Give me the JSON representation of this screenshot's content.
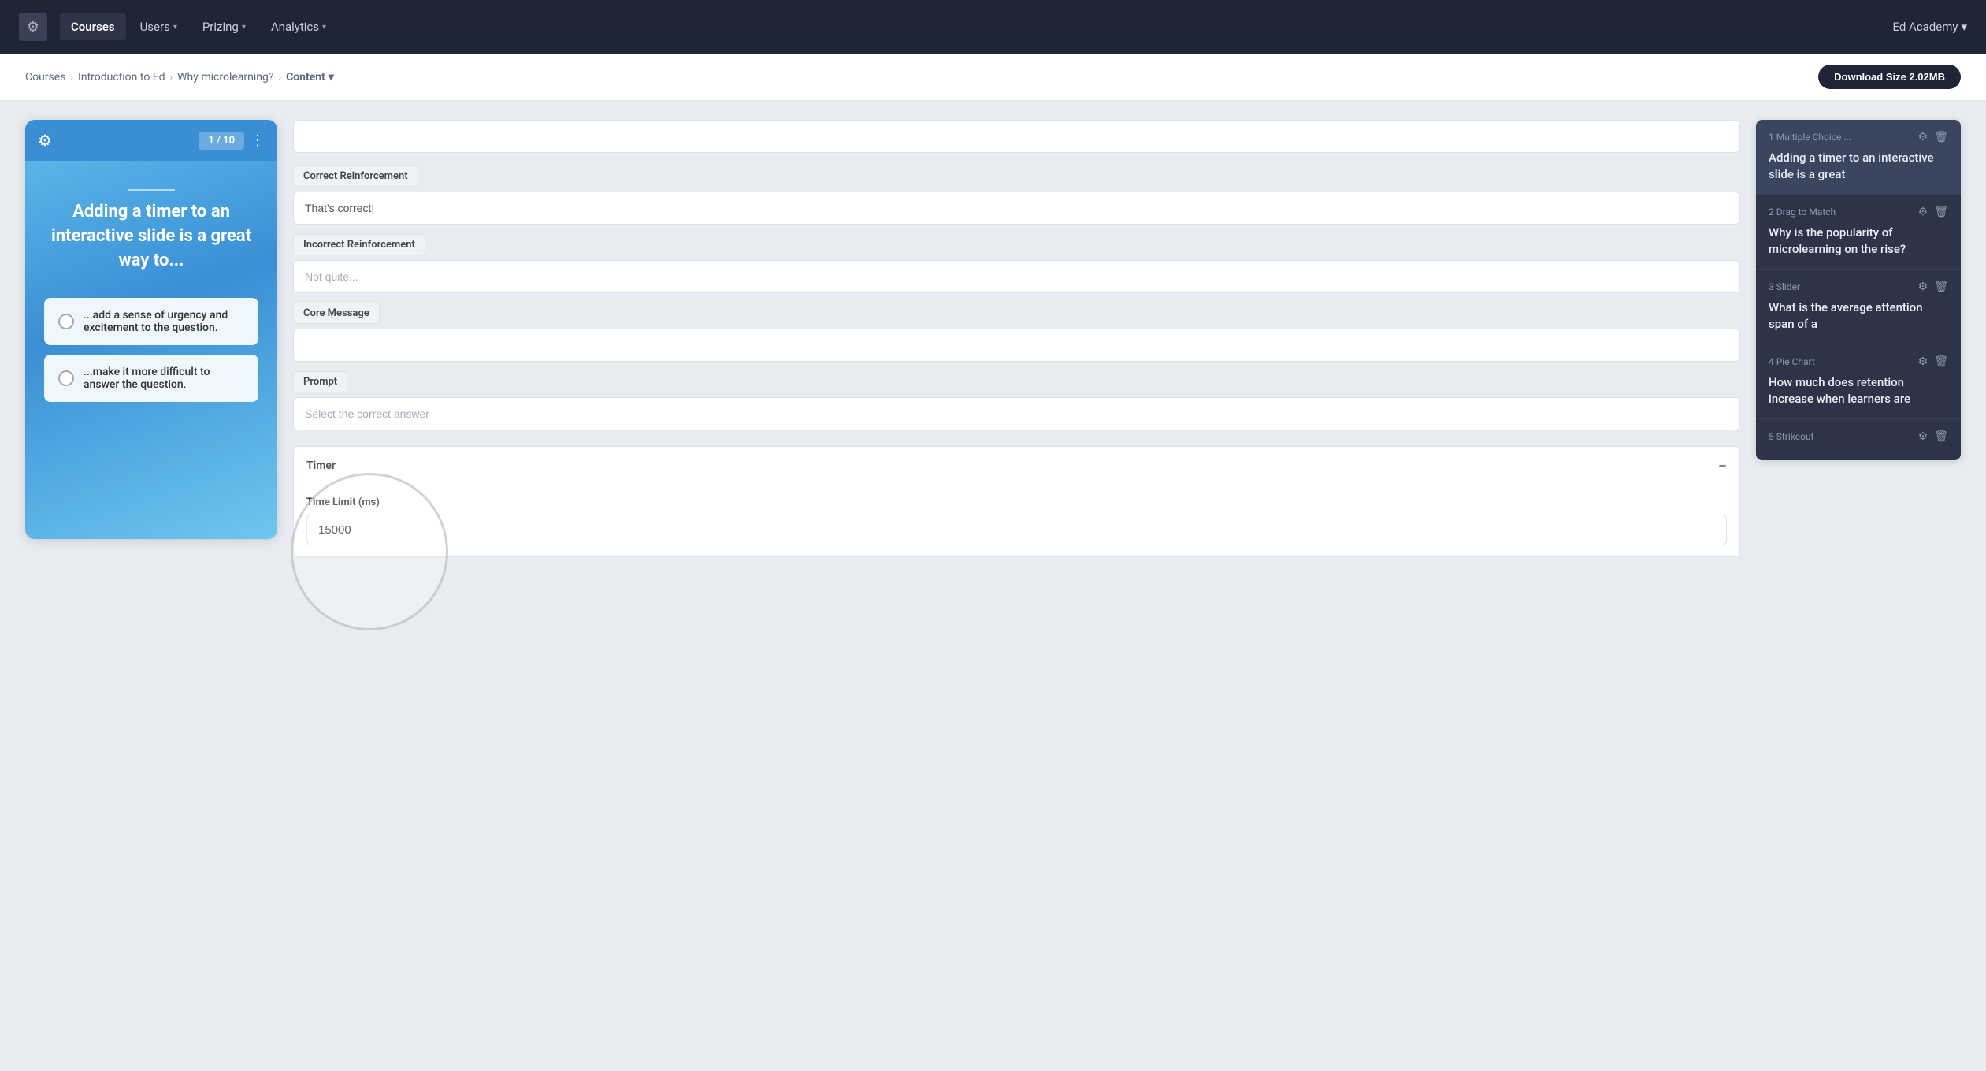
{
  "nav": {
    "logo_icon": "⚙",
    "items": [
      {
        "label": "Courses",
        "active": true
      },
      {
        "label": "Users",
        "has_arrow": true
      },
      {
        "label": "Prizing",
        "has_arrow": true
      },
      {
        "label": "Analytics",
        "has_arrow": true
      }
    ],
    "user_label": "Ed Academy",
    "user_arrow": "▾"
  },
  "breadcrumb": {
    "items": [
      "Courses",
      "Introduction to Ed",
      "Why microlearning?"
    ],
    "current": "Content",
    "current_arrow": "▾"
  },
  "download_button": "Download Size 2.02MB",
  "slide_preview": {
    "counter": "1 / 10",
    "title": "Adding a timer to an interactive slide is a great way to...",
    "options": [
      "...add a sense of urgency and excitement to the question.",
      "...make it more difficult to answer the question."
    ]
  },
  "form": {
    "top_input_placeholder": "",
    "correct_reinforcement": {
      "label": "Correct Reinforcement",
      "value": "That's correct!"
    },
    "incorrect_reinforcement": {
      "label": "Incorrect Reinforcement",
      "placeholder": "Not quite..."
    },
    "core_message": {
      "label": "Core Message",
      "value": ""
    },
    "prompt": {
      "label": "Prompt",
      "placeholder": "Select the correct answer"
    },
    "timer": {
      "label": "Timer",
      "time_limit_label": "Time Limit (ms)",
      "value": "15000"
    }
  },
  "slide_list": [
    {
      "num": "1",
      "type": "Multiple Choice ...",
      "title": "Adding a timer to an interactive slide is a great",
      "active": true
    },
    {
      "num": "2",
      "type": "Drag to Match",
      "title": "Why is the popularity of microlearning on the rise?",
      "active": false
    },
    {
      "num": "3",
      "type": "Slider",
      "title": "What is the average attention span of a",
      "active": false
    },
    {
      "num": "4",
      "type": "Pie Chart",
      "title": "How much does retention increase when learners are",
      "active": false
    },
    {
      "num": "5",
      "type": "Strikeout",
      "title": "",
      "active": false
    }
  ]
}
